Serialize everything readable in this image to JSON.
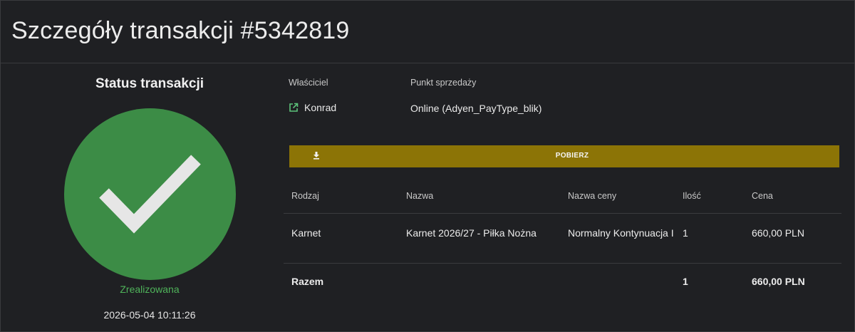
{
  "header": {
    "title": "Szczegóły transakcji #5342819"
  },
  "status": {
    "heading": "Status transakcji",
    "state": "Zrealizowana",
    "datetime": "2026-05-04 10:11:26",
    "color": "#3c8c46",
    "icon": "checkmark-icon"
  },
  "meta": {
    "owner_label": "Właściciel",
    "owner_value": "Konrad",
    "owner_icon": "external-link-icon",
    "pos_label": "Punkt sprzedaży",
    "pos_value": "Online (Adyen_PayType_blik)"
  },
  "download": {
    "label": "POBIERZ",
    "icon": "download-icon",
    "color": "#8c7406"
  },
  "table": {
    "headers": [
      "Rodzaj",
      "Nazwa",
      "Nazwa ceny",
      "Ilość",
      "Cena"
    ],
    "rows": [
      [
        "Karnet",
        "Karnet 2026/27 - Piłka Nożna",
        "Normalny Kontynuacja I",
        "1",
        "660,00 PLN"
      ]
    ],
    "total": {
      "label": "Razem",
      "quantity": "1",
      "price": "660,00 PLN"
    }
  }
}
